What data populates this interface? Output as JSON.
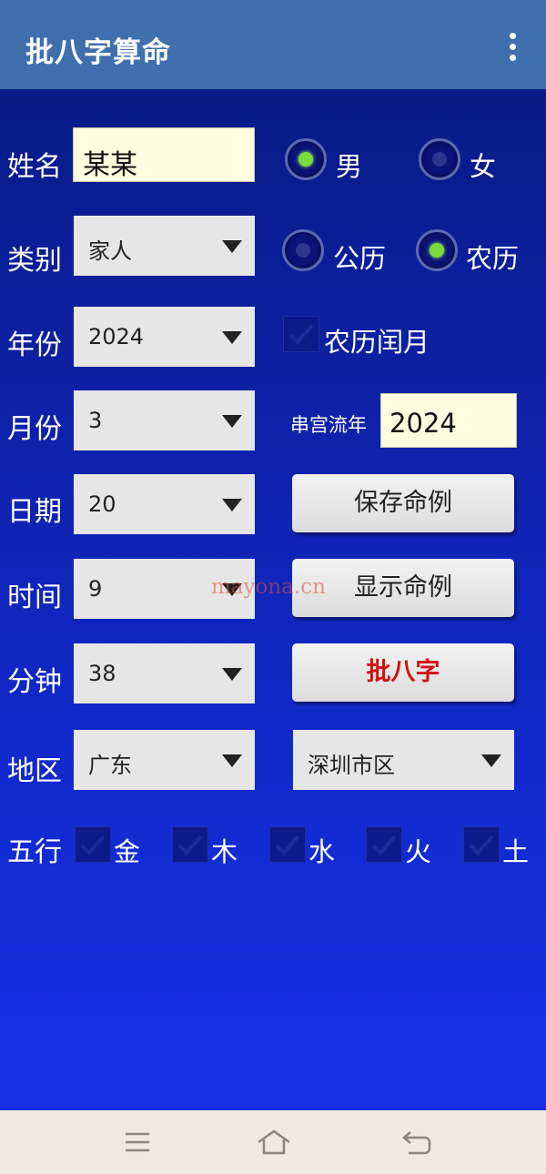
{
  "app": {
    "title": "批八字算命",
    "menu_icon": "more-vert-icon"
  },
  "form": {
    "name": {
      "label": "姓名",
      "value": "某某"
    },
    "gender": {
      "options": [
        "男",
        "女"
      ],
      "selected": "男"
    },
    "category": {
      "label": "类别",
      "value": "家人"
    },
    "calendar": {
      "options": [
        "公历",
        "农历"
      ],
      "selected": "农历"
    },
    "year": {
      "label": "年份",
      "value": "2024"
    },
    "leap_month": {
      "label": "农历闰月",
      "checked": true
    },
    "month": {
      "label": "月份",
      "value": "3"
    },
    "flow_year": {
      "label": "串宫流年",
      "value": "2024"
    },
    "day": {
      "label": "日期",
      "value": "20"
    },
    "hour": {
      "label": "时间",
      "value": "9"
    },
    "minute": {
      "label": "分钟",
      "value": "38"
    },
    "region": {
      "label": "地区",
      "province": "广东",
      "city": "深圳市区"
    },
    "elements": {
      "label": "五行",
      "items": [
        {
          "label": "金",
          "checked": true
        },
        {
          "label": "木",
          "checked": true
        },
        {
          "label": "水",
          "checked": true
        },
        {
          "label": "火",
          "checked": true
        },
        {
          "label": "土",
          "checked": true
        }
      ]
    }
  },
  "buttons": {
    "save": "保存命例",
    "show": "显示命例",
    "compute": "批八字",
    "compute_color": "#d21010"
  },
  "watermark": "mayona.cn",
  "navbar": {
    "icons": [
      "menu-icon",
      "home-icon",
      "back-icon"
    ]
  },
  "colors": {
    "appbar": "#3f6fad",
    "background_top": "#0a1a86",
    "background_bottom": "#1731e6",
    "textbox": "#fffde0",
    "radio_on": "#7cdb3a"
  }
}
